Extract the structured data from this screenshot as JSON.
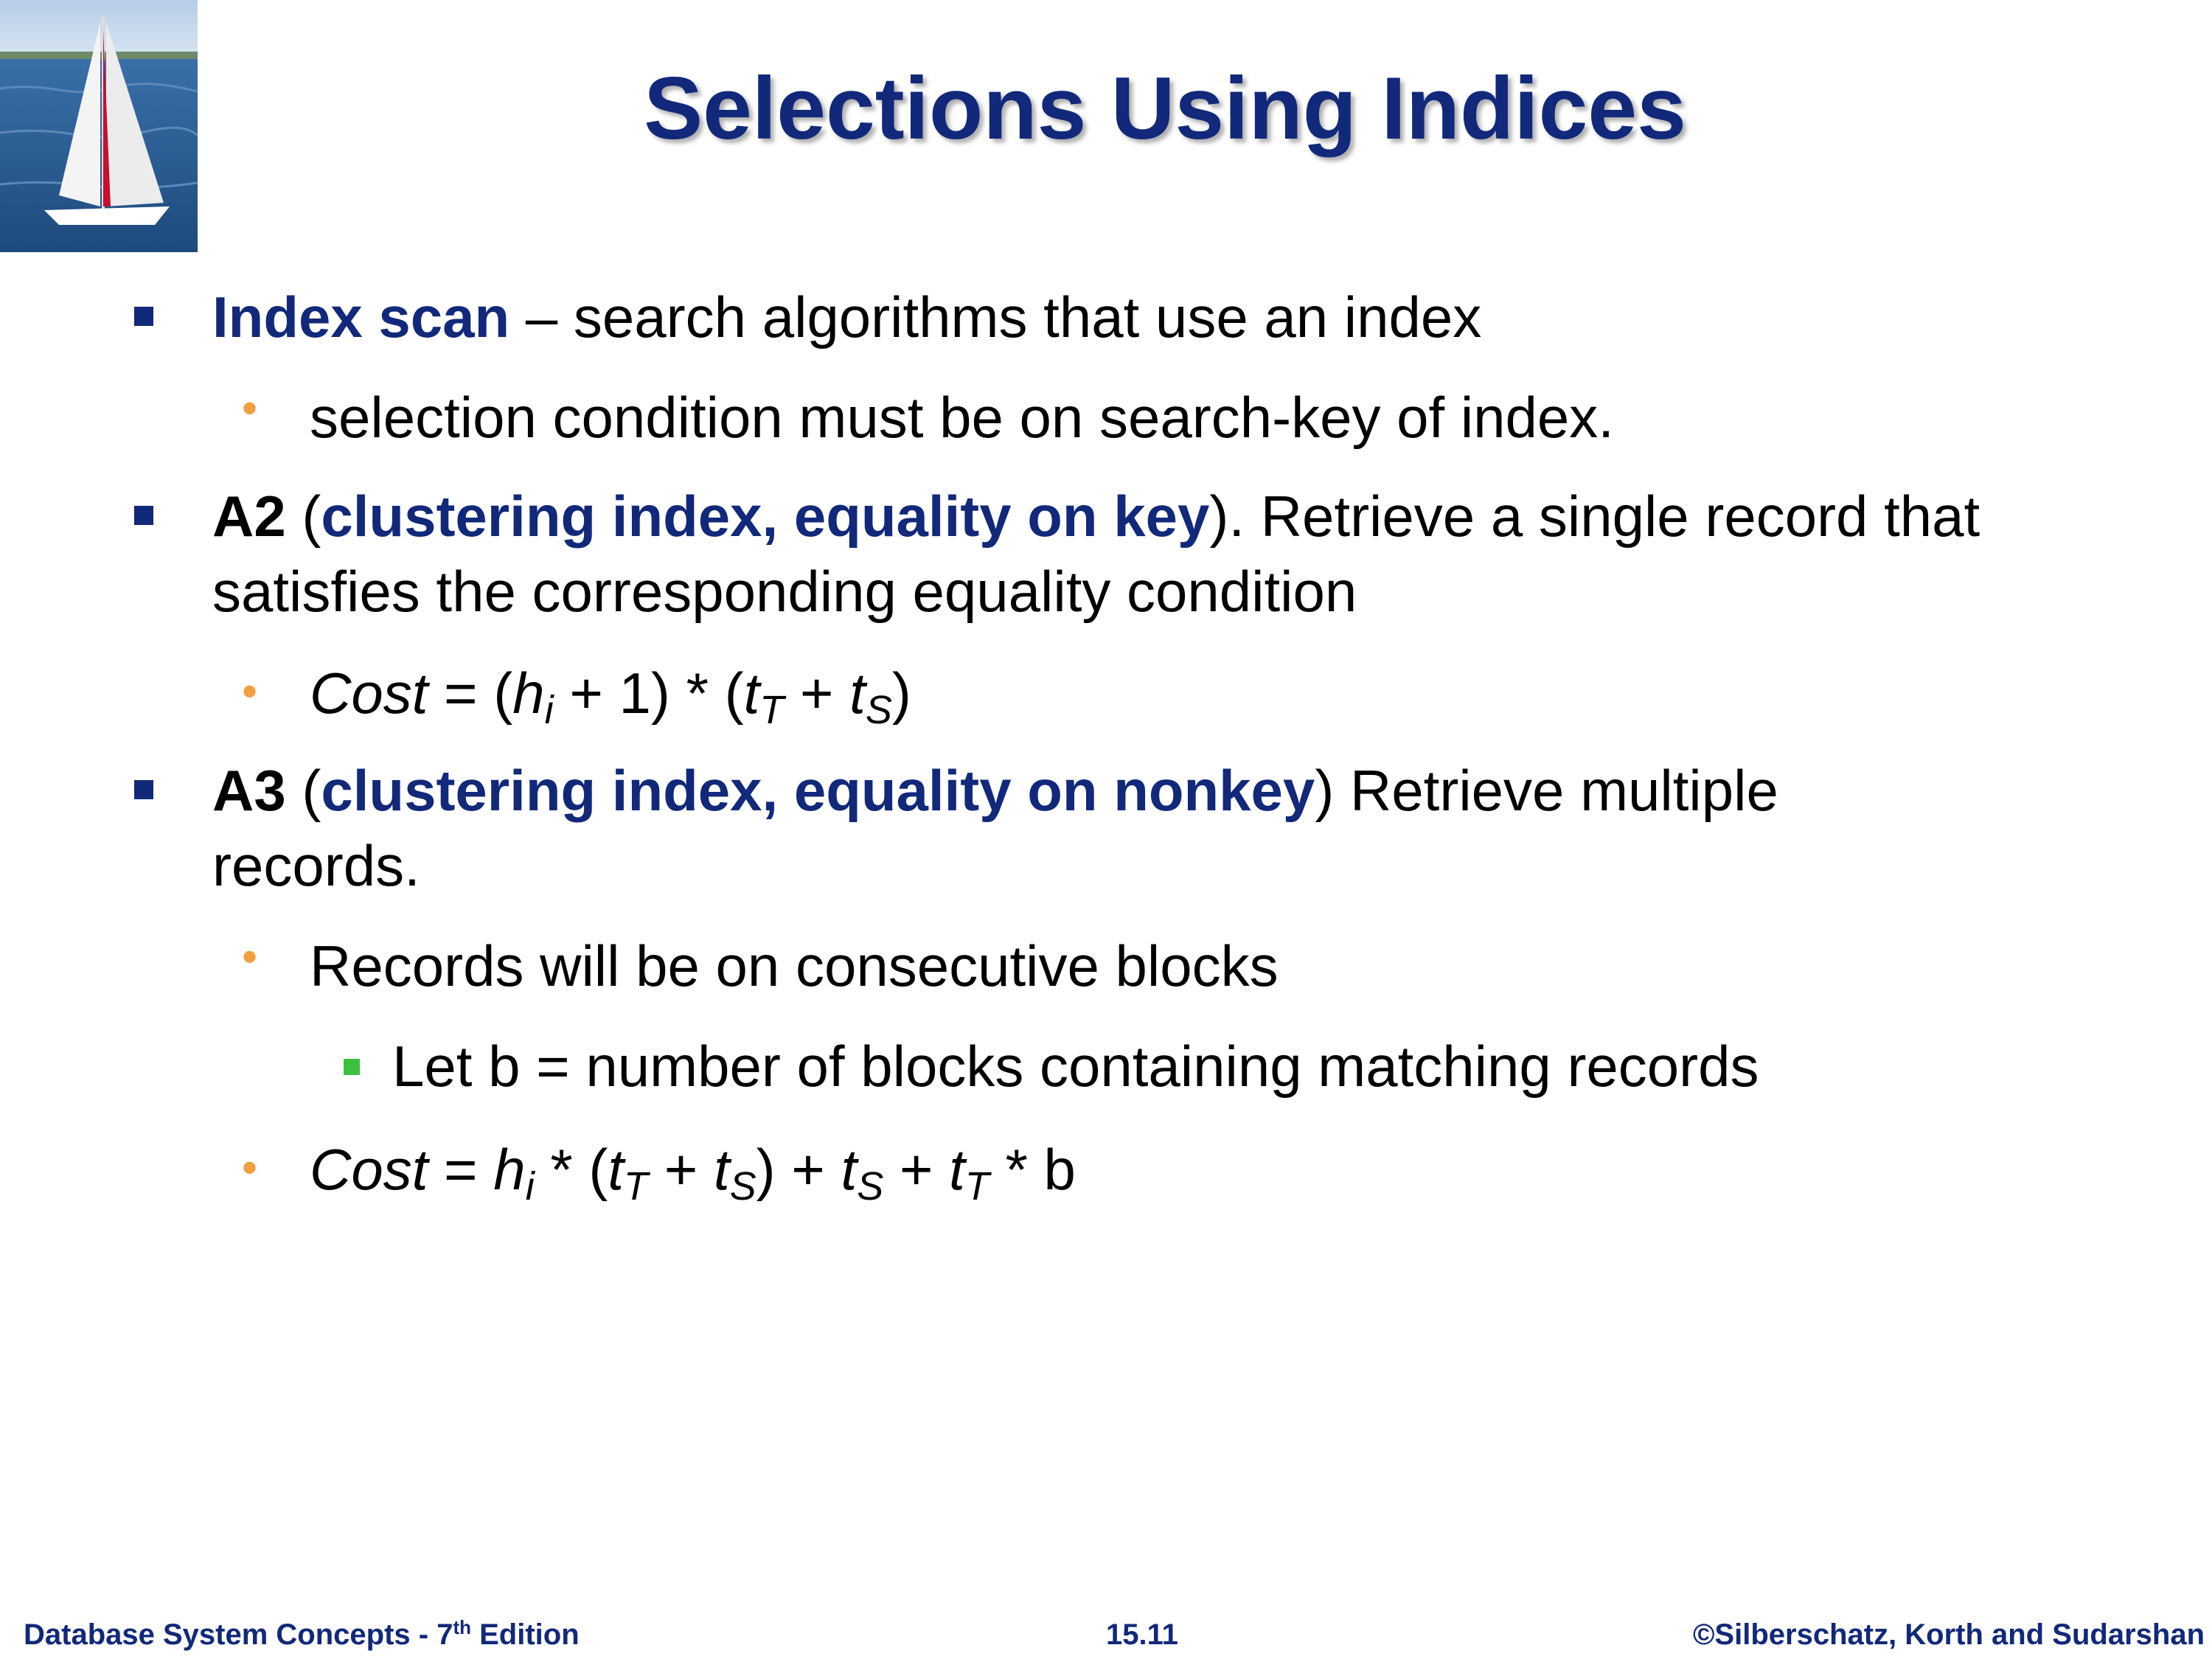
{
  "slide": {
    "title": "Selections Using Indices",
    "bullets": {
      "b1": {
        "term": "Index scan",
        "rest": " – search algorithms that use an index"
      },
      "b1a": {
        "text": "selection condition must be on search-key of index."
      },
      "b2": {
        "code": "A2",
        "open": " (",
        "term": "clustering index, equality on key",
        "rest": ").  Retrieve a single record that",
        "line2": "satisfies the corresponding equality condition"
      },
      "b2a": {
        "cost": "Cost",
        "eq": " = (",
        "h": "h",
        "i": "i",
        "plus1": " + 1) * (",
        "t": "t",
        "T": "T",
        "plus": " + ",
        "t2": "t",
        "S": "S",
        "close": ")"
      },
      "b3": {
        "code": "A3",
        "open": " (",
        "term": "clustering index, equality on nonkey",
        "rest": ") Retrieve multiple",
        "line2": "records."
      },
      "b3a": {
        "text": "Records will be on consecutive blocks"
      },
      "b3a1": {
        "text": "Let b = number of blocks containing matching records"
      },
      "b3b": {
        "cost": "Cost",
        "eq": " = ",
        "h": "h",
        "i": "i",
        "mul": " * (",
        "t": "t",
        "T": "T",
        "plus": " + ",
        "t2": "t",
        "S": "S",
        "close_plus": ") + ",
        "t3": "t",
        "S2": "S",
        "plus2": " + ",
        "t4": "t",
        "T2": "T",
        "tail": " * b"
      }
    }
  },
  "footer": {
    "left_prefix": "Database System Concepts - 7",
    "left_sup": "th",
    "left_suffix": " Edition",
    "center": "15.11",
    "right": "©Silberschatz, Korth and Sudarshan"
  },
  "colors": {
    "title": "#12287a",
    "orange_bullet": "#f0a040",
    "green_bullet": "#3fbf3f"
  },
  "icons": {
    "logo": "sailboat-image"
  }
}
